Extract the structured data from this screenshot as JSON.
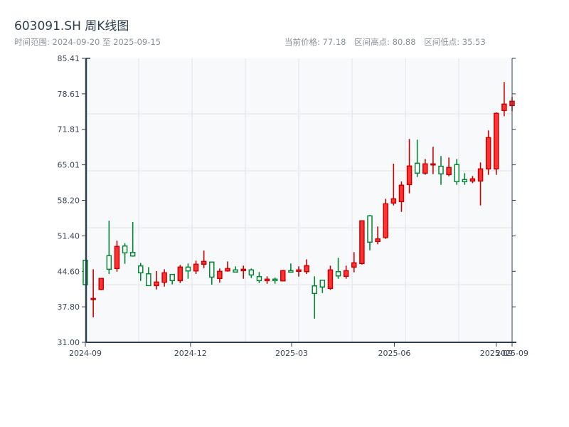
{
  "header": {
    "title": "603091.SH 周K线图",
    "range_label": "时间范围: 2024-09-20 至 2025-09-15",
    "current_price_label": "当前价格: 77.18",
    "high_label": "区间高点: 80.88",
    "low_label": "区间低点: 35.53"
  },
  "colors": {
    "up": "#ff3333",
    "up_stroke": "#cc0000",
    "down": "#008833",
    "plot_bg": "#f7f9fb",
    "grid": "#e2e5ea",
    "axis": "#2c3e50"
  },
  "chart_data": {
    "type": "candlestick",
    "title": "603091.SH 周K线图",
    "ylim": [
      31.0,
      85.41
    ],
    "y_ticks": [
      "31.00",
      "37.80",
      "44.60",
      "51.40",
      "58.20",
      "65.01",
      "71.81",
      "78.61",
      "85.41"
    ],
    "x_ticks": [
      {
        "label": "2024-09",
        "at_index": 0
      },
      {
        "label": "2024-12",
        "at_index": 13.3
      },
      {
        "label": "2025-03",
        "at_index": 26.1
      },
      {
        "label": "2025-06",
        "at_index": 39.1
      },
      {
        "label": "2025-09",
        "at_index": 52
      },
      {
        "label": "2025-09",
        "at_index": 54
      }
    ],
    "grid": true,
    "fields": [
      "open",
      "high",
      "low",
      "close"
    ],
    "candles": [
      [
        46.72,
        46.72,
        42.05,
        42.05
      ],
      [
        39.2,
        45.0,
        35.8,
        39.4
      ],
      [
        41.13,
        43.23,
        41.0,
        43.23
      ],
      [
        47.6,
        54.3,
        44.1,
        45.0
      ],
      [
        45.14,
        50.46,
        44.54,
        49.37
      ],
      [
        49.45,
        50.0,
        46.04,
        48.14
      ],
      [
        48.2,
        54.05,
        47.4,
        47.54
      ],
      [
        45.63,
        46.2,
        42.77,
        44.32
      ],
      [
        44.13,
        45.4,
        41.77,
        41.87
      ],
      [
        41.87,
        44.64,
        41.13,
        42.55
      ],
      [
        42.5,
        45.0,
        41.68,
        44.32
      ],
      [
        44.0,
        44.0,
        42.09,
        42.83
      ],
      [
        42.82,
        45.82,
        42.36,
        45.41
      ],
      [
        45.41,
        46.1,
        43.18,
        44.68
      ],
      [
        44.68,
        46.64,
        44.09,
        45.96
      ],
      [
        45.96,
        48.59,
        45.22,
        46.5
      ],
      [
        46.37,
        46.37,
        42.05,
        43.5
      ],
      [
        43.23,
        45.14,
        42.45,
        44.6
      ],
      [
        44.68,
        46.5,
        44.54,
        45.14
      ],
      [
        44.87,
        45.55,
        44.46,
        44.46
      ],
      [
        44.73,
        45.69,
        43.18,
        45.0
      ],
      [
        44.87,
        45.14,
        43.31,
        43.91
      ],
      [
        43.59,
        44.46,
        42.36,
        42.82
      ],
      [
        42.82,
        43.64,
        42.22,
        43.1
      ],
      [
        43.1,
        43.4,
        42.22,
        42.82
      ],
      [
        42.77,
        44.87,
        42.77,
        44.73
      ],
      [
        44.73,
        46.1,
        44.46,
        44.46
      ],
      [
        44.6,
        45.55,
        43.59,
        44.87
      ],
      [
        44.54,
        46.9,
        44.09,
        45.69
      ],
      [
        41.81,
        43.64,
        35.53,
        40.37
      ],
      [
        42.9,
        42.9,
        40.45,
        41.6
      ],
      [
        41.32,
        45.69,
        41.05,
        44.87
      ],
      [
        44.54,
        47.19,
        43.18,
        43.72
      ],
      [
        43.64,
        45.69,
        43.18,
        44.73
      ],
      [
        45.41,
        48.28,
        44.4,
        46.23
      ],
      [
        46.1,
        54.28,
        45.9,
        54.28
      ],
      [
        55.23,
        55.4,
        48.63,
        50.19
      ],
      [
        50.32,
        53.19,
        49.78,
        50.82
      ],
      [
        51.09,
        58.5,
        50.82,
        57.55
      ],
      [
        57.69,
        65.23,
        57.23,
        58.5
      ],
      [
        57.96,
        61.82,
        56.0,
        61.1
      ],
      [
        61.23,
        69.96,
        59.55,
        64.78
      ],
      [
        65.32,
        69.82,
        62.68,
        63.41
      ],
      [
        63.41,
        66.14,
        63.09,
        65.19
      ],
      [
        65.05,
        68.46,
        63.23,
        65.19
      ],
      [
        64.73,
        66.69,
        61.18,
        63.28
      ],
      [
        63.14,
        66.41,
        62.82,
        64.5
      ],
      [
        65.05,
        66.14,
        61.18,
        61.78
      ],
      [
        62.19,
        63.41,
        61.18,
        61.78
      ],
      [
        61.91,
        62.87,
        61.5,
        62.32
      ],
      [
        61.91,
        65.46,
        57.23,
        64.23
      ],
      [
        64.23,
        71.6,
        63.09,
        70.23
      ],
      [
        64.23,
        75.05,
        63.09,
        74.87
      ],
      [
        75.42,
        80.88,
        74.32,
        76.64
      ],
      [
        76.37,
        78.0,
        75.28,
        77.18
      ]
    ]
  }
}
